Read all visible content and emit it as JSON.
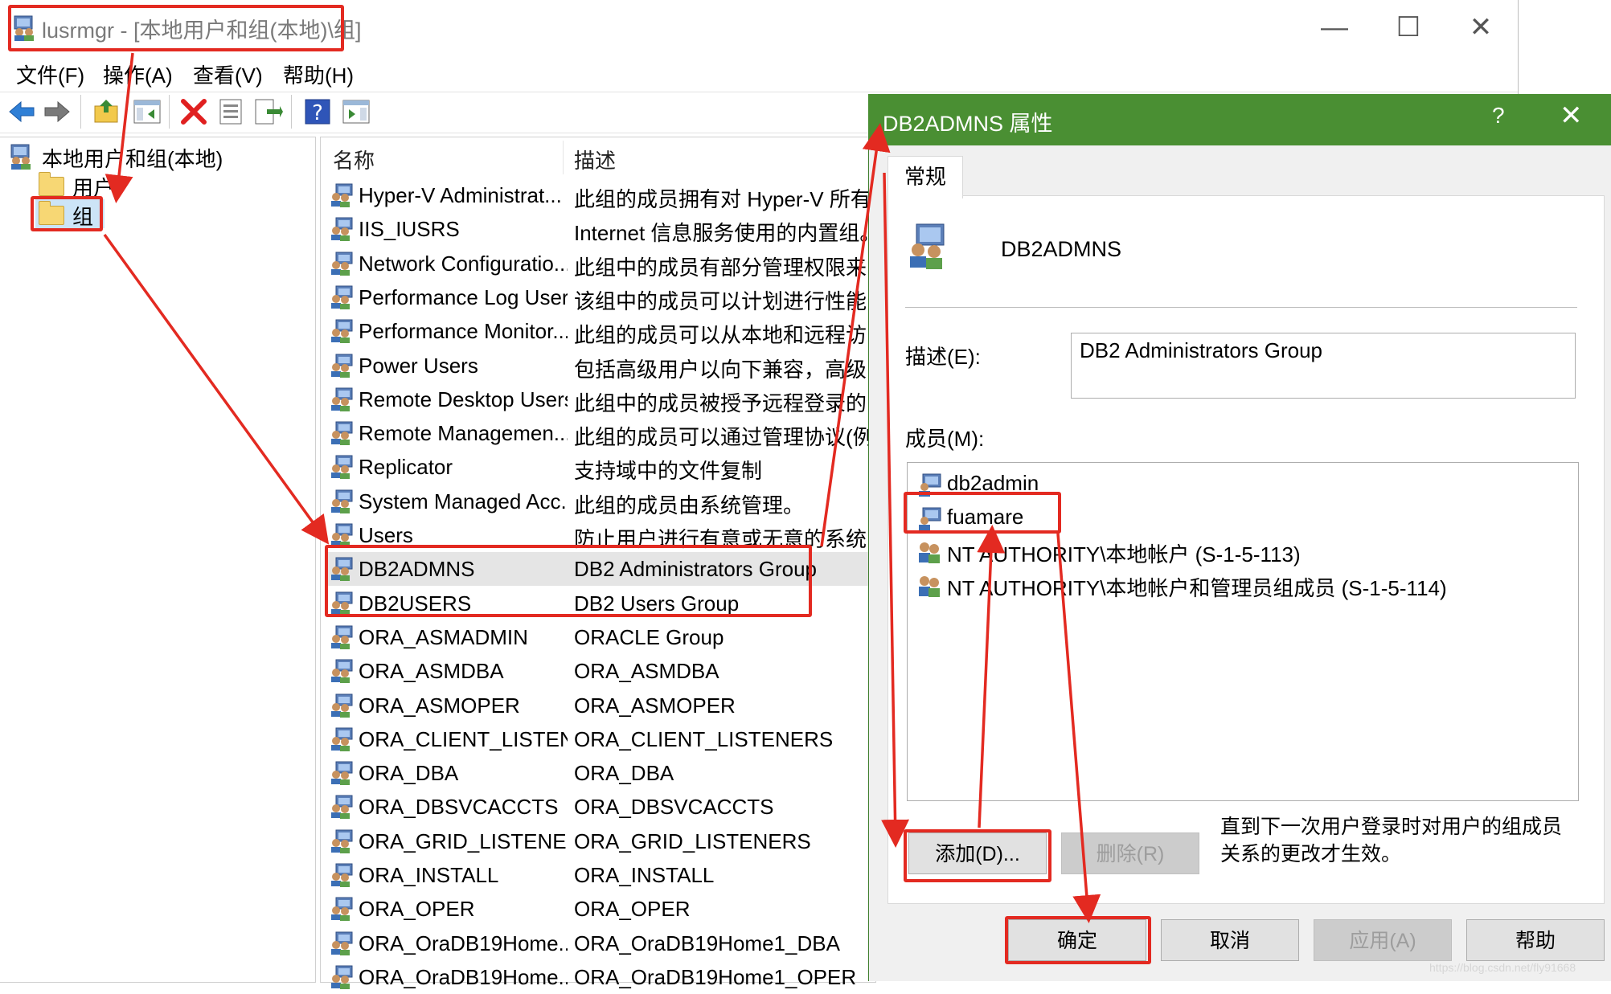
{
  "window": {
    "title": "lusrmgr - [本地用户和组(本地)\\组]",
    "controls": {
      "minimize": "—",
      "maximize": "☐",
      "close": "✕"
    }
  },
  "menu": [
    "文件(F)",
    "操作(A)",
    "查看(V)",
    "帮助(H)"
  ],
  "toolbar": {
    "icons": [
      "back-arrow-icon",
      "forward-arrow-icon",
      "up-folder-icon",
      "show-hide-tree-icon",
      "delete-icon",
      "properties-icon",
      "export-list-icon",
      "help-icon",
      "show-hide-action-pane-icon"
    ]
  },
  "tree": {
    "root": "本地用户和组(本地)",
    "items": [
      {
        "label": "用户"
      },
      {
        "label": "组"
      }
    ]
  },
  "list": {
    "columns": [
      "名称",
      "描述"
    ],
    "rows": [
      {
        "name": "Hyper-V Administrat...",
        "desc": "此组的成员拥有对 Hyper-V 所有..."
      },
      {
        "name": "IIS_IUSRS",
        "desc": "Internet 信息服务使用的内置组。"
      },
      {
        "name": "Network Configuratio...",
        "desc": "此组中的成员有部分管理权限来..."
      },
      {
        "name": "Performance Log Users",
        "desc": "该组中的成员可以计划进行性能..."
      },
      {
        "name": "Performance Monitor...",
        "desc": "此组的成员可以从本地和远程访..."
      },
      {
        "name": "Power Users",
        "desc": "包括高级用户以向下兼容，高级..."
      },
      {
        "name": "Remote Desktop Users",
        "desc": "此组中的成员被授予远程登录的..."
      },
      {
        "name": "Remote Managemen...",
        "desc": "此组的成员可以通过管理协议(例..."
      },
      {
        "name": "Replicator",
        "desc": "支持域中的文件复制"
      },
      {
        "name": "System Managed Acc...",
        "desc": "此组的成员由系统管理。"
      },
      {
        "name": "Users",
        "desc": "防止用户进行有意或无意的系统..."
      },
      {
        "name": "DB2ADMNS",
        "desc": "DB2 Administrators Group",
        "selected": true
      },
      {
        "name": "DB2USERS",
        "desc": "DB2 Users Group"
      },
      {
        "name": "ORA_ASMADMIN",
        "desc": "ORACLE Group"
      },
      {
        "name": "ORA_ASMDBA",
        "desc": "ORA_ASMDBA"
      },
      {
        "name": "ORA_ASMOPER",
        "desc": "ORA_ASMOPER"
      },
      {
        "name": "ORA_CLIENT_LISTEN...",
        "desc": "ORA_CLIENT_LISTENERS"
      },
      {
        "name": "ORA_DBA",
        "desc": "ORA_DBA"
      },
      {
        "name": "ORA_DBSVCACCTS",
        "desc": "ORA_DBSVCACCTS"
      },
      {
        "name": "ORA_GRID_LISTENERS",
        "desc": "ORA_GRID_LISTENERS"
      },
      {
        "name": "ORA_INSTALL",
        "desc": "ORA_INSTALL"
      },
      {
        "name": "ORA_OPER",
        "desc": "ORA_OPER"
      },
      {
        "name": "ORA_OraDB19Home...",
        "desc": "ORA_OraDB19Home1_DBA"
      },
      {
        "name": "ORA_OraDB19Home...",
        "desc": "ORA_OraDB19Home1_OPER"
      }
    ]
  },
  "dialog": {
    "title": "DB2ADMNS 属性",
    "help": "?",
    "close": "✕",
    "tab": "常规",
    "group_name": "DB2ADMNS",
    "desc_label": "描述(E):",
    "desc_value": "DB2 Administrators Group",
    "members_label": "成员(M):",
    "members": [
      {
        "name": "db2admin",
        "icon": "user-icon"
      },
      {
        "name": "fuamare",
        "icon": "user-icon"
      },
      {
        "name": "NT AUTHORITY\\本地帐户 (S-1-5-113)",
        "icon": "group-icon"
      },
      {
        "name": "NT AUTHORITY\\本地帐户和管理员组成员 (S-1-5-114)",
        "icon": "group-icon"
      }
    ],
    "add_button": "添加(D)...",
    "remove_button": "删除(R)",
    "note": "直到下一次用户登录时对用户的组成员关系的更改才生效。",
    "ok_button": "确定",
    "cancel_button": "取消",
    "apply_button": "应用(A)",
    "help_button": "帮助"
  },
  "annotation_color": "#e32a21",
  "accent_color": "#4a8f33",
  "watermark": "https://blog.csdn.net/fly91668"
}
